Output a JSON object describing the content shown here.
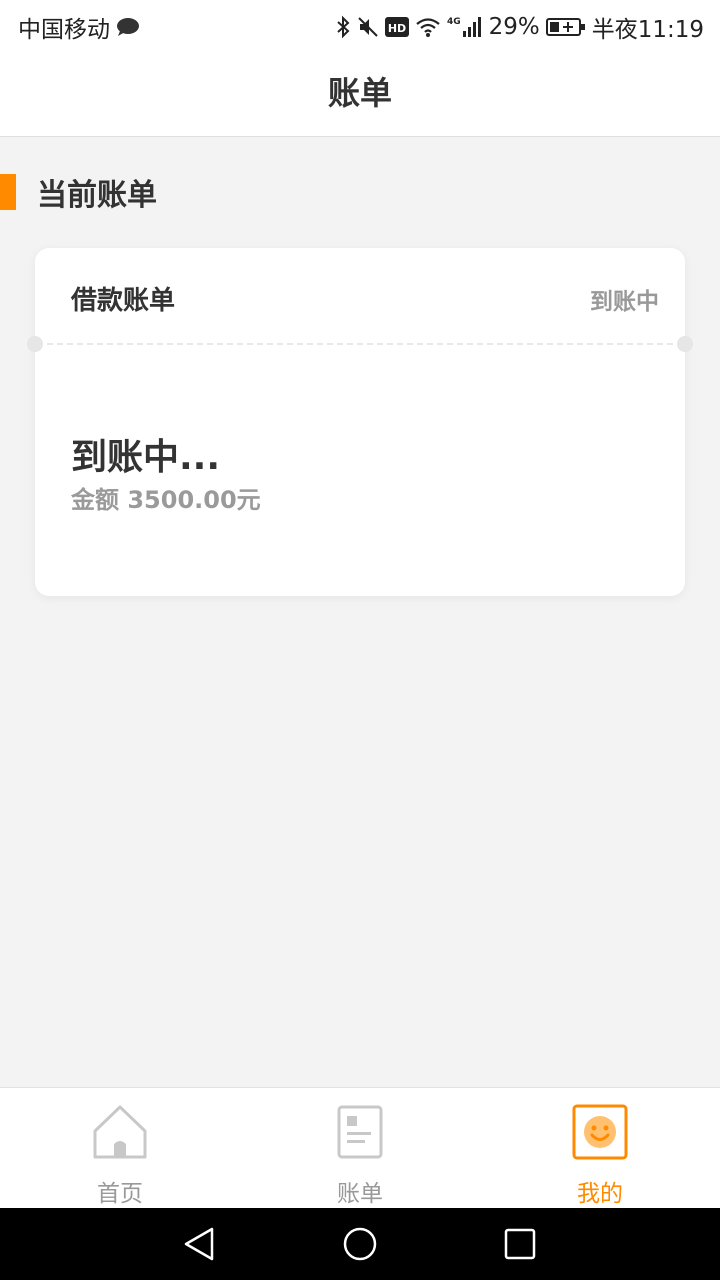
{
  "status_bar": {
    "carrier": "中国移动",
    "network": "4G",
    "battery": "29%",
    "time": "半夜11:19"
  },
  "header": {
    "title": "账单"
  },
  "section": {
    "title": "当前账单"
  },
  "bill_card": {
    "type_label": "借款账单",
    "status_small": "到账中",
    "status_big": "到账中...",
    "amount_text": "金额 3500.00元"
  },
  "bottom_nav": {
    "items": [
      {
        "label": "首页",
        "icon": "home-icon"
      },
      {
        "label": "账单",
        "icon": "bill-icon"
      },
      {
        "label": "我的",
        "icon": "smiley-icon",
        "active": true
      }
    ]
  },
  "colors": {
    "accent": "#ff8a00",
    "background": "#f3f3f3",
    "muted_text": "#999999",
    "primary_text": "#333333"
  }
}
